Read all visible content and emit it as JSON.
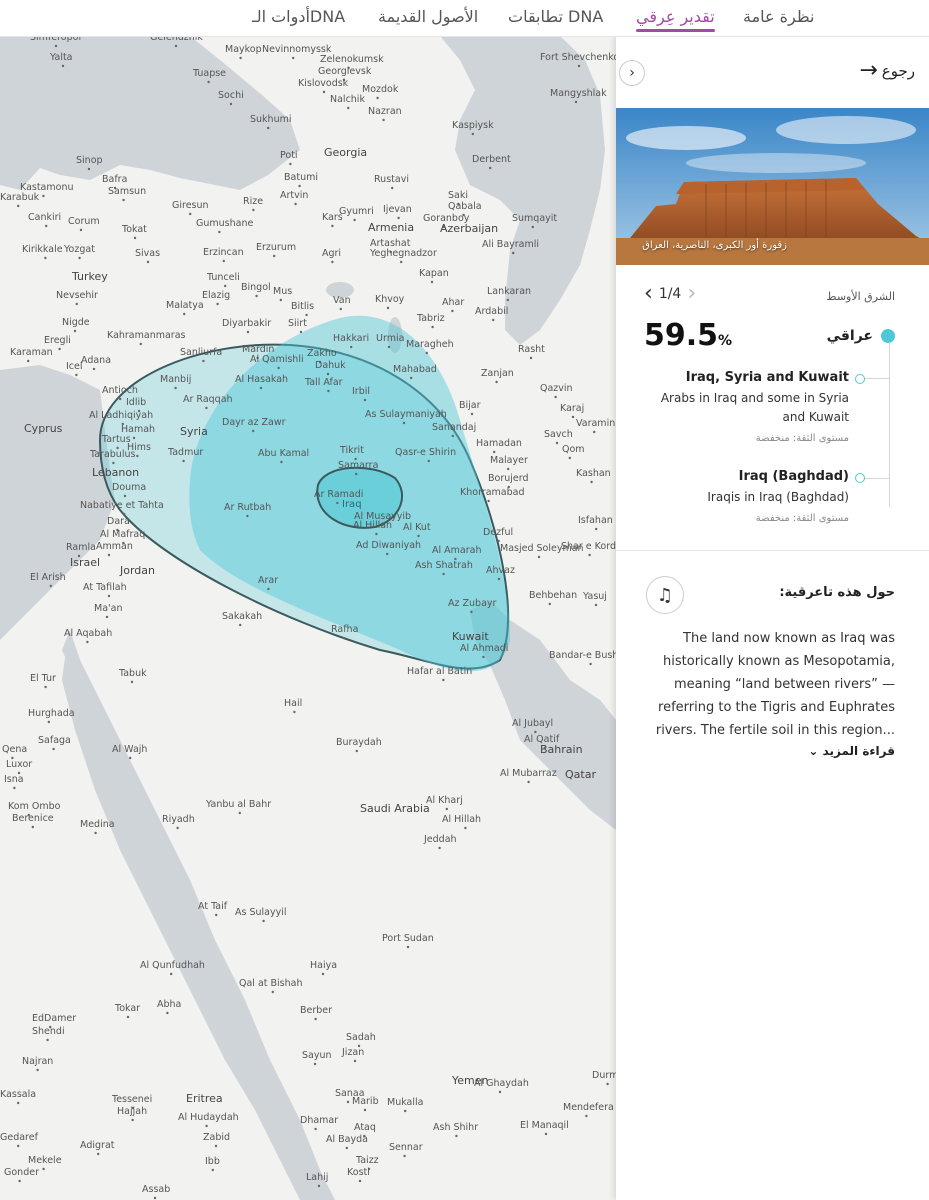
{
  "nav": {
    "tabs": [
      {
        "label": "نظرة عامة",
        "active": false
      },
      {
        "label": "تقدير عِرقي",
        "active": true
      },
      {
        "label": "تطابقات DNA",
        "active": false
      },
      {
        "label": "الأصول القديمة",
        "active": false
      },
      {
        "label": "أدوات الـDNA",
        "active": false
      }
    ]
  },
  "colors": {
    "accent": "#a24aa4",
    "region": "#4ec8d6",
    "water": "#cfd4d8",
    "land": "#f2f2f0"
  },
  "panel": {
    "back_label": "رجوع",
    "collapse_icon": "chevron-right-icon",
    "photo_caption": "زقورة أور الكبرى، الناصرية، العراق",
    "region_label": "الشرق الأوسط",
    "pager": "1/4",
    "percent": "59.5",
    "percent_unit": "%",
    "main_population": "عراقي",
    "subregions": [
      {
        "title": "Iraq, Syria and Kuwait",
        "desc": "Arabs in Iraq and some in Syria and Kuwait",
        "confidence": "مستوى الثقة: منخفضة"
      },
      {
        "title": "Iraq (Baghdad)",
        "desc": "Iraqis in Iraq (Baghdad)",
        "confidence": "مستوى الثقة: منخفضة"
      }
    ],
    "about_title": "حول هذه تاعرقية:",
    "about_icon": "music-note-icon",
    "about_text": "The land now known as Iraq was historically known as Mesopotamia, meaning “land between rivers” — referring to the Tigris and Euphrates rivers. The fertile soil in this region...",
    "read_more": "قراءة المزيد"
  },
  "map": {
    "country_labels": [
      "Georgia",
      "Armenia",
      "Azerbaijan",
      "Turkey",
      "Syria",
      "Iraq",
      "Lebanon",
      "Israel",
      "Jordan",
      "Saudi Arabia",
      "Kuwait",
      "Bahrain",
      "Qatar",
      "Cyprus",
      "Eritrea",
      "Yemen"
    ],
    "city_labels": [
      "Simferopol",
      "Gelendzhik",
      "Maykop",
      "Nevinnomyssk",
      "Zelenokumsk",
      "Georgievsk",
      "Kislovodsk",
      "Mozdok",
      "Nalchik",
      "Nazran",
      "Yalta",
      "Tuapse",
      "Sochi",
      "Sukhumi",
      "Poti",
      "Kaspiysk",
      "Derbent",
      "Fort Shevchenko",
      "Mangyshlak",
      "Sinop",
      "Kastamonu",
      "Karabuk",
      "Bafra",
      "Samsun",
      "Batumi",
      "Rustavi",
      "Artvin",
      "Giresun",
      "Rize",
      "Saki",
      "Qabala",
      "Cankiri",
      "Corum",
      "Tokat",
      "Gumushane",
      "Kars",
      "Gyumri",
      "Ijevan",
      "Goranboy",
      "Sumqayit",
      "Kirikkale",
      "Yozgat",
      "Sivas",
      "Erzincan",
      "Erzurum",
      "Agri",
      "Artashat",
      "Yeghegnadzor",
      "Ali Bayramli",
      "Tunceli",
      "Kapan",
      "Nevsehir",
      "Elazig",
      "Bingol",
      "Mus",
      "Lankaran",
      "Malatya",
      "Bitlis",
      "Van",
      "Khvoy",
      "Ahar",
      "Ardabil",
      "Nigde",
      "Diyarbakir",
      "Siirt",
      "Tabriz",
      "Eregli",
      "Kahramanmaras",
      "Hakkari",
      "Urmia",
      "Maragheh",
      "Karaman",
      "Sanliurfa",
      "Mardin",
      "Al Qamishli",
      "Zakho",
      "Dahuk",
      "Mahabad",
      "Rasht",
      "Icel",
      "Adana",
      "Manbij",
      "Al Hasakah",
      "Tall Afar",
      "Zanjan",
      "Antioch",
      "Idlib",
      "Ar Raqqah",
      "Irbil",
      "Qazvin",
      "Bijar",
      "Karaj",
      "Al Ladhiqiyah",
      "Hamah",
      "As Sulaymaniyah",
      "Varamin",
      "Tartus",
      "Hims",
      "Sanandaj",
      "Tarabulus",
      "Dayr az Zawr",
      "Hamadan",
      "Savch",
      "Qom",
      "Tadmur",
      "Tikrit",
      "Qasr-e Shirin",
      "Malayer",
      "Abu Kamal",
      "Samarra",
      "Borujerd",
      "Kashan",
      "Douma",
      "Nabatiye et Tahta",
      "Ar Ramadi",
      "Khorramabad",
      "Dara",
      "Ar Rutbah",
      "Al Musayyib",
      "Al Kut",
      "Isfahan",
      "Al Mafraq",
      "Amman",
      "Al Hillah",
      "Dezful",
      "Shar e Kord",
      "Ramla",
      "Ad Diwaniyah",
      "Al Amarah",
      "Masjed Soleyman",
      "Ash Shatrah",
      "Ahvaz",
      "El Arish",
      "At Tafilah",
      "Arar",
      "Az Zubayr",
      "Behbehan",
      "Yasuj",
      "Ma'an",
      "Sakakah",
      "Rafha",
      "Al Ahmadi",
      "Bandar-e Bushehr",
      "Al Aqabah",
      "Tabuk",
      "Hafar al Batin",
      "El Tur",
      "Hail",
      "Al Jubayl",
      "Al Qatif",
      "Hurghada",
      "Safaga",
      "Al Wajh",
      "Buraydah",
      "Qena",
      "Luxor",
      "Isna",
      "Al Mubarraz",
      "Kom Ombo",
      "Berenice",
      "Medina",
      "Yanbu al Bahr",
      "Riyadh",
      "Al Kharj",
      "Al Hillah",
      "Jeddah",
      "At Taif",
      "As Sulayyil",
      "Port Sudan",
      "Al Qunfudhah",
      "Qal at Bishah",
      "Haiya",
      "Tokar",
      "Abha",
      "Berber",
      "EdDamer",
      "Shendi",
      "Najran",
      "Sadah",
      "Jizan",
      "Sayun",
      "Al Ghaydah",
      "Durman",
      "Kassala",
      "Tessenei",
      "Hajjah",
      "Sanaa",
      "Marib",
      "Mukalla",
      "Mendefera",
      "Al Hudaydah",
      "Dhamar",
      "Ataq",
      "Ash Shihr",
      "El Manaqil",
      "Gedaref",
      "Adigrat",
      "Zabid",
      "Al Bayda",
      "Sennar",
      "Mekele",
      "Ibb",
      "Taizz",
      "Kosti",
      "Gonder",
      "Assab",
      "Lahij"
    ]
  }
}
